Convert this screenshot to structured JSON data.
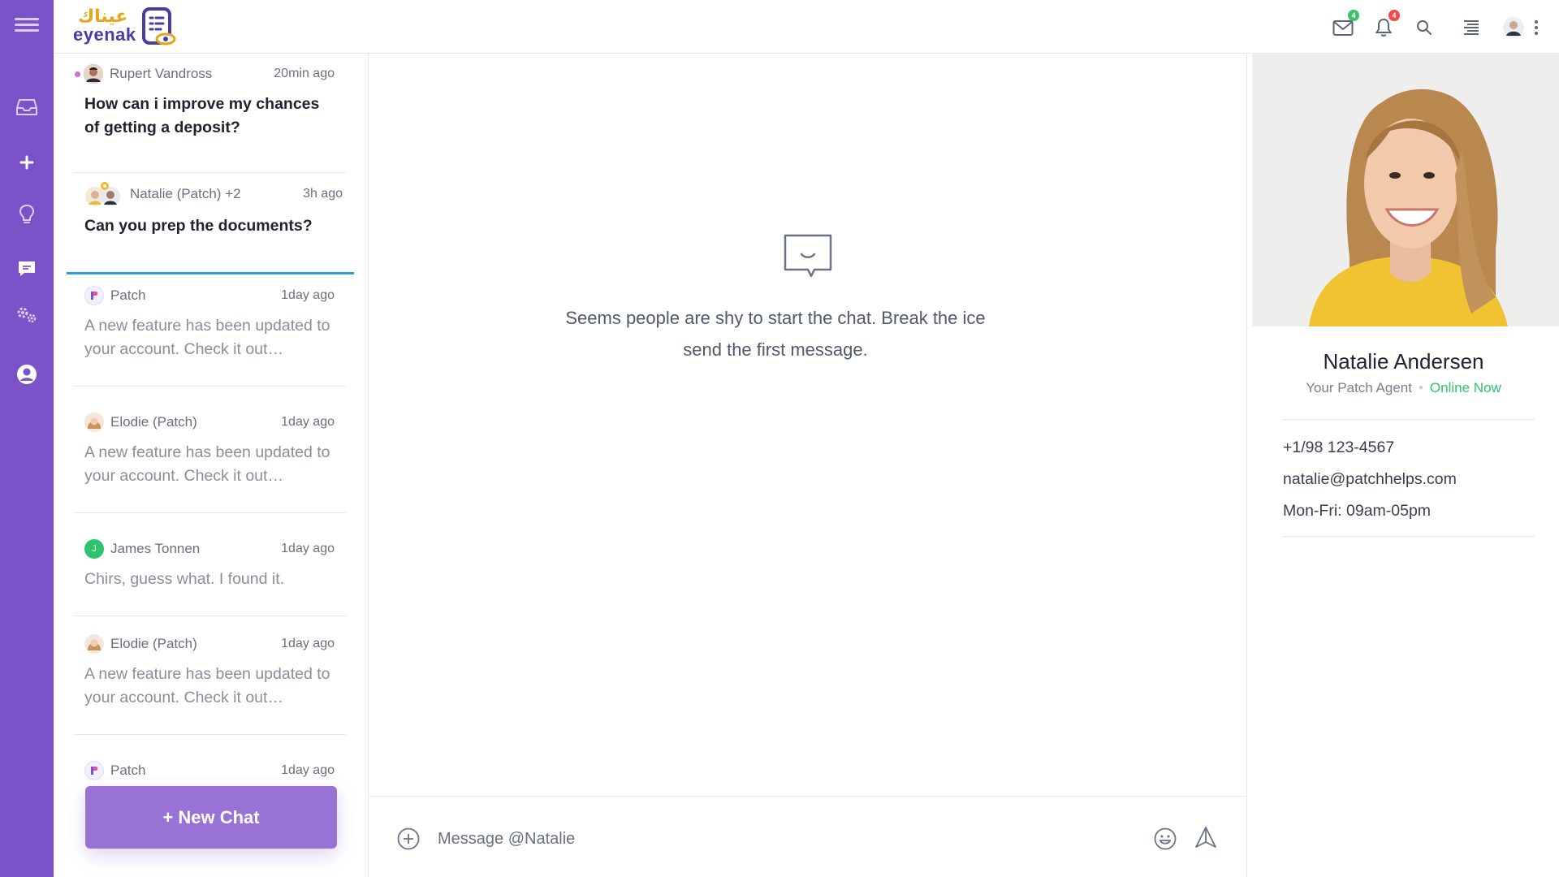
{
  "logo": {
    "arabic": "عيناك",
    "latin": "eyenak"
  },
  "rail": {
    "items": [
      "menu",
      "inbox",
      "add",
      "ideas",
      "chat",
      "settings",
      "account"
    ]
  },
  "topbar": {
    "mail_badge": "4",
    "bell_badge": "4",
    "colors": {
      "mail_badge": "#3cc06a",
      "bell_badge": "#ef4a4a"
    }
  },
  "chats": [
    {
      "name": "Rupert Vandross",
      "time": "20min ago",
      "message": "How can i improve my chances of getting a deposit?",
      "unread": true
    },
    {
      "name": "Natalie (Patch) +2",
      "time": "3h ago",
      "message": "Can you prep the documents?",
      "selected": true
    },
    {
      "name": "Patch",
      "time": "1day ago",
      "message": "A new feature has been updated to your account. Check it out…"
    },
    {
      "name": "Elodie (Patch)",
      "time": "1day ago",
      "message": "A new feature has been updated to your account. Check it out…"
    },
    {
      "name": "James Tonnen",
      "time": "1day ago",
      "message": "Chirs, guess what. I found it.",
      "initial": "J"
    },
    {
      "name": "Elodie (Patch)",
      "time": "1day ago",
      "message": "A new feature has been updated to your account. Check it out…"
    },
    {
      "name": "Patch",
      "time": "1day ago",
      "message": ""
    }
  ],
  "new_chat_label": "+ New Chat",
  "main": {
    "empty_text": "Seems people are shy to start the chat. Break the ice send the first message.",
    "composer_placeholder": "Message @Natalie"
  },
  "profile": {
    "name": "Natalie Andersen",
    "role": "Your Patch Agent",
    "status": "Online Now",
    "phone": "+1/98 123-4567",
    "email": "natalie@patchhelps.com",
    "hours": "Mon-Fri: 09am-05pm"
  },
  "colors": {
    "rail": "#7c52c9",
    "accent_blue": "#2f9be0",
    "online": "#2ec36c",
    "new_chat": "#9872d4"
  }
}
